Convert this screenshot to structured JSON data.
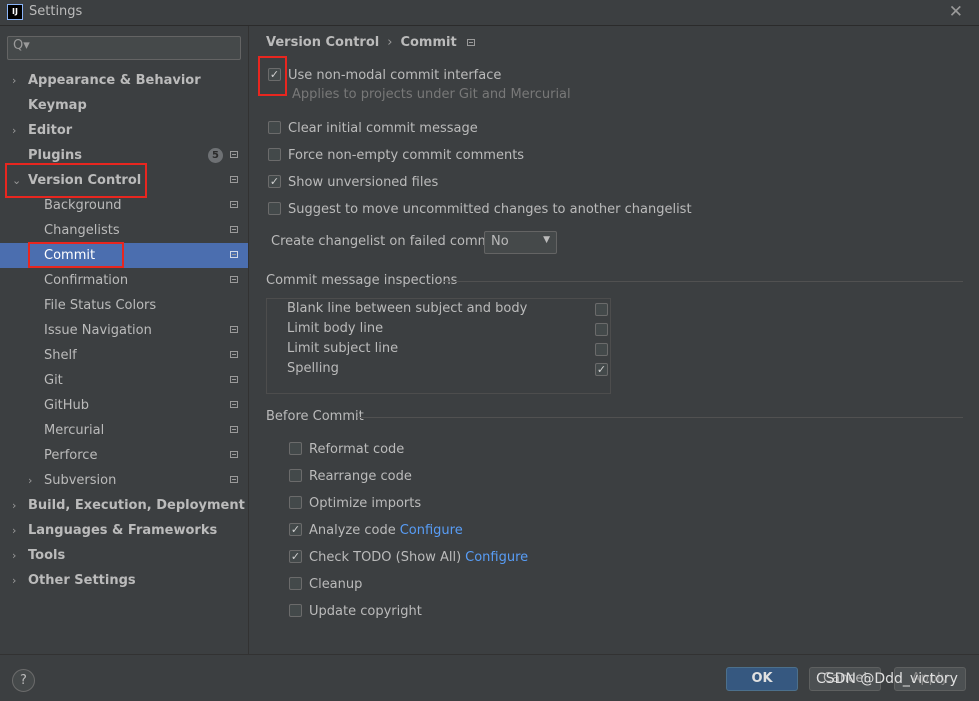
{
  "window": {
    "title": "Settings",
    "logo_text": "IJ"
  },
  "search": {
    "placeholder": "",
    "icon": "Q▾"
  },
  "sidebar": {
    "items": [
      {
        "label": "Appearance & Behavior"
      },
      {
        "label": "Keymap"
      },
      {
        "label": "Editor"
      },
      {
        "label": "Plugins",
        "badge": "5"
      },
      {
        "label": "Version Control"
      },
      {
        "label": "Background"
      },
      {
        "label": "Changelists"
      },
      {
        "label": "Commit"
      },
      {
        "label": "Confirmation"
      },
      {
        "label": "File Status Colors"
      },
      {
        "label": "Issue Navigation"
      },
      {
        "label": "Shelf"
      },
      {
        "label": "Git"
      },
      {
        "label": "GitHub"
      },
      {
        "label": "Mercurial"
      },
      {
        "label": "Perforce"
      },
      {
        "label": "Subversion"
      },
      {
        "label": "Build, Execution, Deployment"
      },
      {
        "label": "Languages & Frameworks"
      },
      {
        "label": "Tools"
      },
      {
        "label": "Other Settings"
      }
    ]
  },
  "breadcrumb": {
    "parent": "Version Control",
    "separator": "›",
    "current": "Commit"
  },
  "options": {
    "non_modal": {
      "label": "Use non-modal commit interface",
      "checked": true,
      "hint": "Applies to projects under Git and Mercurial"
    },
    "clear_initial": {
      "label": "Clear initial commit message",
      "checked": false
    },
    "force_non_empty": {
      "label": "Force non-empty commit comments",
      "checked": false
    },
    "show_unversioned": {
      "label": "Show unversioned files",
      "checked": true
    },
    "suggest_move": {
      "label": "Suggest to move uncommitted changes to another changelist",
      "checked": false
    }
  },
  "changelist": {
    "label": "Create changelist on failed commit:",
    "value": "No"
  },
  "inspections": {
    "title": "Commit message inspections",
    "rows": [
      {
        "label": "Blank line between subject and body",
        "checked": false
      },
      {
        "label": "Limit body line",
        "checked": false
      },
      {
        "label": "Limit subject line",
        "checked": false
      },
      {
        "label": "Spelling",
        "checked": true
      }
    ]
  },
  "before_commit": {
    "title": "Before Commit",
    "items": [
      {
        "label": "Reformat code",
        "checked": false
      },
      {
        "label": "Rearrange code",
        "checked": false
      },
      {
        "label": "Optimize imports",
        "checked": false
      },
      {
        "label": "Analyze code",
        "checked": true,
        "link": "Configure"
      },
      {
        "label": "Check TODO (Show All)",
        "checked": true,
        "link": "Configure"
      },
      {
        "label": "Cleanup",
        "checked": false
      },
      {
        "label": "Update copyright",
        "checked": false
      }
    ]
  },
  "buttons": {
    "help": "?",
    "ok": "OK",
    "cancel": "Cancel",
    "apply": "Apply"
  },
  "watermark": "CSDN @Ddd_victory",
  "colors": {
    "selection": "#4b6eaf",
    "link": "#589df6",
    "highlight_box": "#e8261f"
  }
}
